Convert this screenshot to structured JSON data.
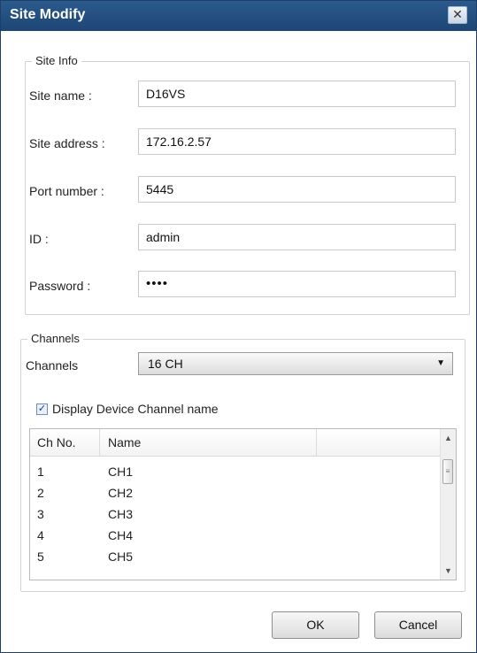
{
  "window": {
    "title": "Site Modify",
    "close_symbol": "✕"
  },
  "site_info": {
    "legend": "Site Info",
    "fields": [
      {
        "label": "Site name :",
        "value": "D16VS"
      },
      {
        "label": "Site address :",
        "value": "172.16.2.57"
      },
      {
        "label": "Port number :",
        "value": "5445"
      },
      {
        "label": "ID :",
        "value": "admin"
      },
      {
        "label": "Password :",
        "value": "••••"
      }
    ]
  },
  "channels": {
    "legend": "Channels",
    "select_label": "Channels",
    "select_value": "16 CH",
    "select_arrow": "▼",
    "checkbox_label": "Display Device Channel name",
    "checkbox_mark": "✓",
    "columns": [
      "Ch No.",
      "Name"
    ],
    "rows": [
      {
        "no": "1",
        "name": "CH1"
      },
      {
        "no": "2",
        "name": "CH2"
      },
      {
        "no": "3",
        "name": "CH3"
      },
      {
        "no": "4",
        "name": "CH4"
      },
      {
        "no": "5",
        "name": "CH5"
      }
    ],
    "scroll_up": "▲",
    "scroll_down": "▼",
    "thumb_grip": "≡"
  },
  "buttons": {
    "ok": "OK",
    "cancel": "Cancel"
  }
}
